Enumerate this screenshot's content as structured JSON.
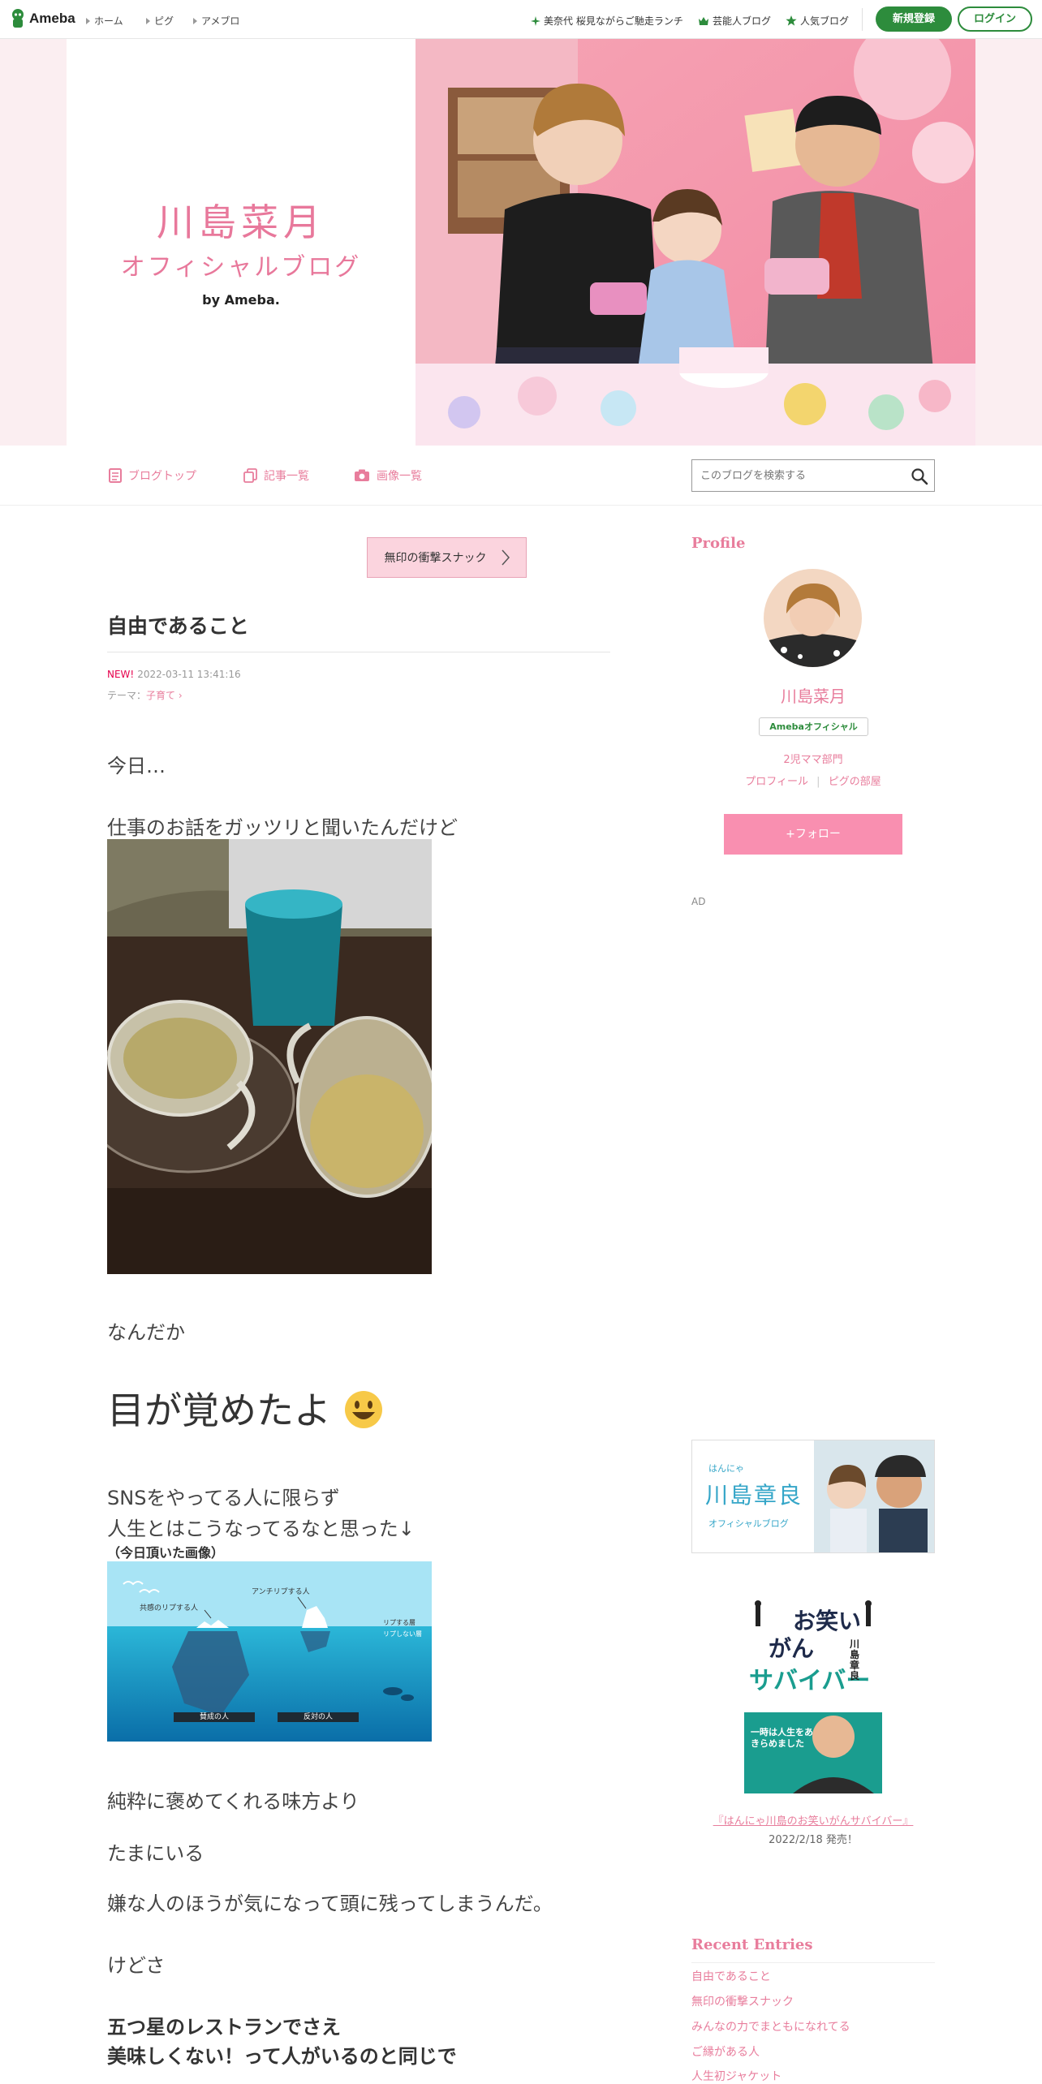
{
  "topbar": {
    "logo": "Ameba",
    "nav": [
      "ホーム",
      "ピグ",
      "アメブロ"
    ],
    "right_links": [
      "美奈代 桜見ながらご馳走ランチ",
      "芸能人ブログ",
      "人気ブログ"
    ],
    "register": "新規登録",
    "login": "ログイン"
  },
  "header": {
    "title": "川島菜月",
    "subtitle": "オフィシャルブログ",
    "by": "by Ameba."
  },
  "blog_nav": {
    "items": [
      "ブログトップ",
      "記事一覧",
      "画像一覧"
    ],
    "search_placeholder": "このブログを検索する"
  },
  "article": {
    "pr_button": "無印の衝撃スナック",
    "title": "自由であること",
    "new_label": "NEW!",
    "datetime": "2022-03-11 13:41:16",
    "theme_label": "テーマ：",
    "theme": "子育て",
    "paragraphs": [
      "今日…",
      "仕事のお話をガッツリと聞いたんだけど",
      "なんだか",
      "目が覚めたよ",
      "SNSをやってる人に限らず",
      "人生とはこうなってるなと思った↓",
      "（今日頂いた画像）",
      "純粋に褒めてくれる味方より",
      "たまにいる",
      "嫌な人のほうが気になって頭に残ってしまうんだ。",
      "けどさ",
      "五つ星のレストランでさえ",
      "美味しくない！って人がいるのと同じで"
    ],
    "iceberg": {
      "top_right": "アンチリプする人",
      "top_left": "共感のリプする人",
      "legend1": "リプする層",
      "legend2": "リプしない層",
      "box_left": "賛成の人",
      "box_right": "反対の人"
    }
  },
  "sidebar": {
    "profile_heading": "Profile",
    "name": "川島菜月",
    "badge": "Amebaオフィシャル",
    "rank": "2児ママ部門",
    "profile_link": "プロフィール",
    "pig_link": "ピグの部屋",
    "follow": "+フォロー",
    "ad": "AD",
    "banner": {
      "small": "はんにゃ",
      "name": "川島章良",
      "sub": "オフィシャルブログ"
    },
    "book": {
      "line1": "お笑い",
      "line2": "がん",
      "line3": "サバイバー",
      "author": "川島章良",
      "caption": "一時は人生をあきらめました"
    },
    "book_link": "『はんにゃ川島のお笑いがんサバイバー』",
    "book_date": "2022/2/18 発売！",
    "recent_heading": "Recent Entries",
    "recent": [
      "自由であること",
      "無印の衝撃スナック",
      "みんなの力でまともになれてる",
      "ご縁がある人",
      "人生初ジャケット"
    ]
  }
}
